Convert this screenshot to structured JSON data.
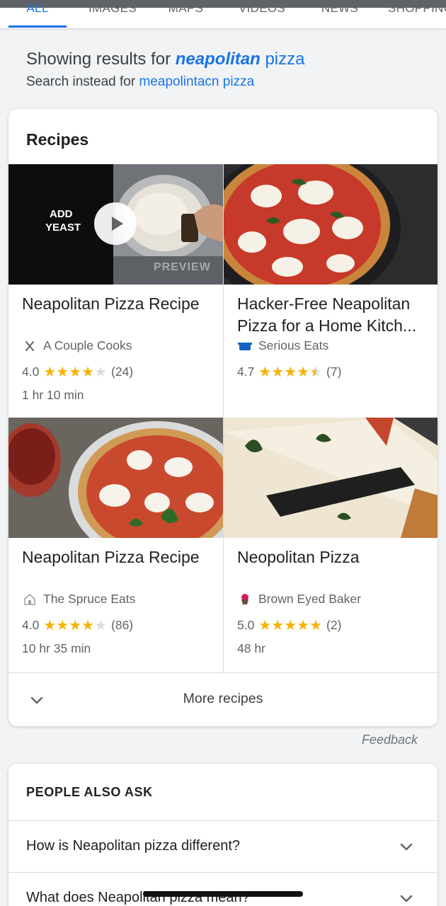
{
  "tabs": [
    {
      "label": "ALL",
      "active": true
    },
    {
      "label": "IMAGES",
      "active": false
    },
    {
      "label": "MAPS",
      "active": false
    },
    {
      "label": "VIDEOS",
      "active": false
    },
    {
      "label": "NEWS",
      "active": false
    },
    {
      "label": "SHOPPING",
      "active": false
    }
  ],
  "correction": {
    "prefix": "Showing results for",
    "corrected_word": "neapolitan",
    "rest": "pizza",
    "instead_prefix": "Search instead for",
    "original_query": "meapolintacn pizza"
  },
  "recipes": {
    "heading": "Recipes",
    "items": [
      {
        "title": "Neapolitan Pizza Recipe",
        "source": "A Couple Cooks",
        "source_icon": "x-icon",
        "rating": "4.0",
        "stars": 4,
        "reviews": "(24)",
        "time": "1 hr 10 min",
        "video": true,
        "overlay_text_1": "ADD",
        "overlay_text_2": "YEAST",
        "preview_label": "PREVIEW"
      },
      {
        "title": "Hacker-Free Neapolitan Pizza for a Home Kitch...",
        "source": "Serious Eats",
        "source_icon": "pot-icon",
        "rating": "4.7",
        "stars": 4.5,
        "reviews": "(7)",
        "time": "",
        "video": false
      },
      {
        "title": "Neapolitan Pizza Recipe",
        "source": "The Spruce Eats",
        "source_icon": "house-icon",
        "rating": "4.0",
        "stars": 4,
        "reviews": "(86)",
        "time": "10 hr 35 min",
        "video": false
      },
      {
        "title": "Neopolitan Pizza",
        "source": "Brown Eyed Baker",
        "source_icon": "cupcake-icon",
        "rating": "5.0",
        "stars": 5,
        "reviews": "(2)",
        "time": "48 hr",
        "video": false
      }
    ],
    "more_label": "More recipes"
  },
  "feedback": "Feedback",
  "paa": {
    "heading": "PEOPLE ALSO ASK",
    "questions": [
      "How is Neapolitan pizza different?",
      "What does Neapolitan pizza mean?"
    ]
  },
  "colors": {
    "accent": "#1a73e8",
    "star": "#f4b400"
  }
}
